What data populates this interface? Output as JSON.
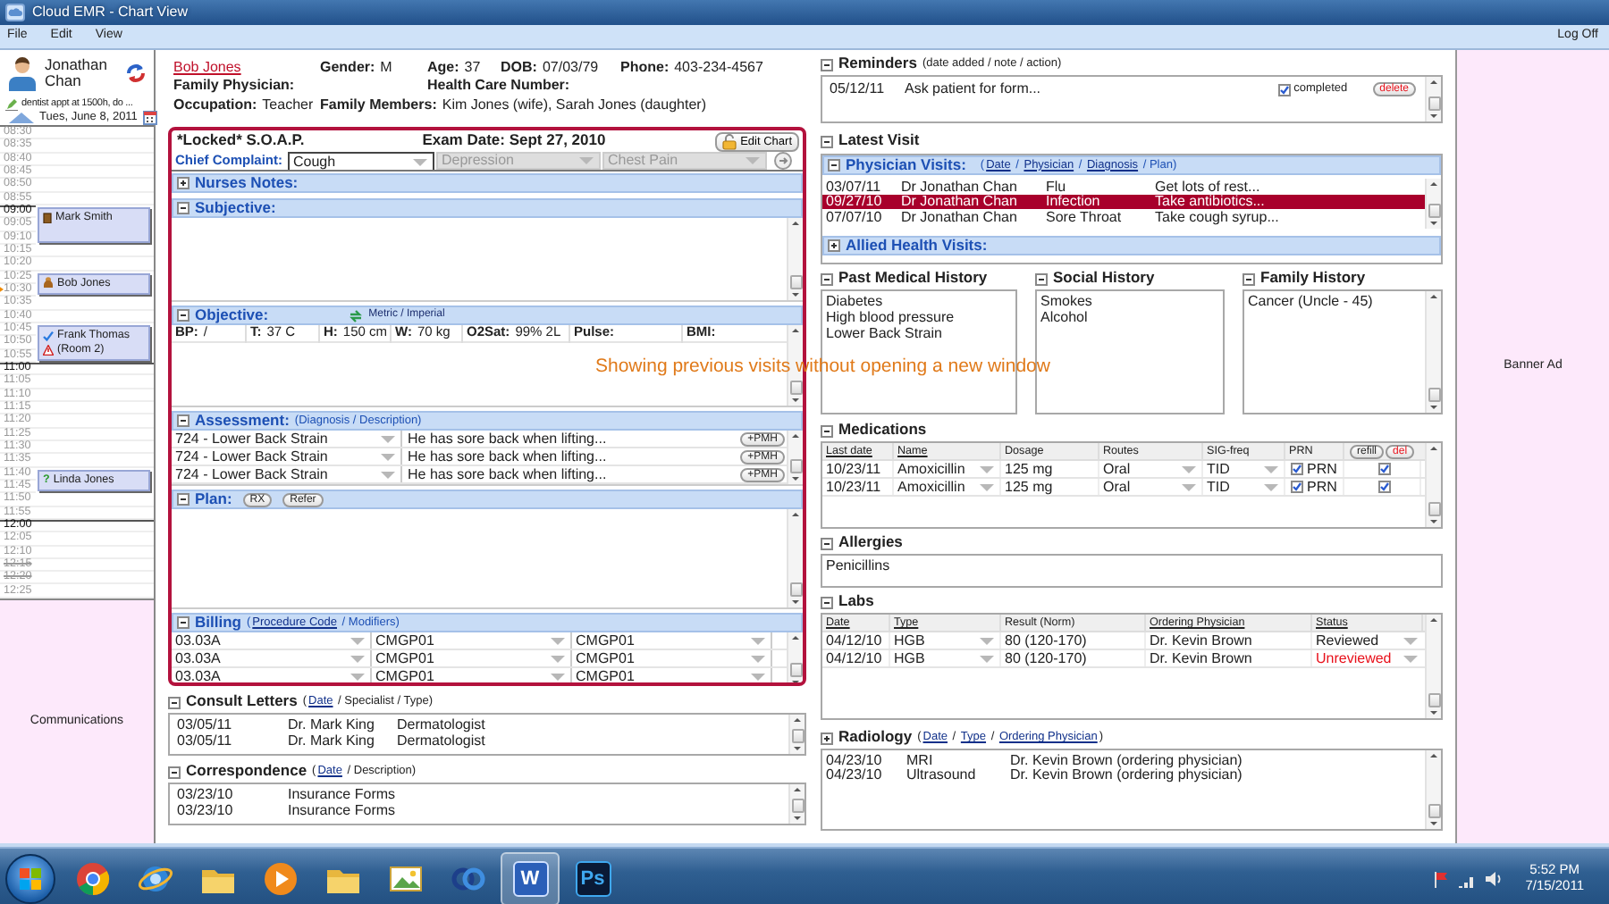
{
  "window": {
    "title": "Cloud EMR - Chart View"
  },
  "menu": [
    "File",
    "Edit",
    "View"
  ],
  "log_off": "Log Off",
  "sidebar": {
    "doctor": "Jonathan Chan",
    "note": "dentist appt at 1500h, do ...",
    "date": "Tues, June 8, 2011",
    "slots": [
      {
        "kind": "free",
        "time": "08:30",
        "hour": false,
        "struck": false,
        "now": false
      },
      {
        "kind": "free",
        "time": "08:35",
        "hour": false,
        "struck": false,
        "now": false
      },
      {
        "kind": "free",
        "time": "08:40",
        "hour": false,
        "struck": false,
        "now": false
      },
      {
        "kind": "free",
        "time": "08:45",
        "hour": false,
        "struck": false,
        "now": false
      },
      {
        "kind": "free",
        "time": "08:50",
        "hour": false,
        "struck": false,
        "now": false
      },
      {
        "kind": "free",
        "time": "08:55",
        "hour": false,
        "struck": false,
        "now": false
      },
      {
        "kind": "appointment",
        "times": [
          {
            "time": "09:00",
            "hour": true,
            "struck": false,
            "now": false
          },
          {
            "time": "09:05",
            "hour": false,
            "struck": false,
            "now": false
          },
          {
            "time": "09:10",
            "hour": false,
            "struck": false,
            "now": false
          }
        ],
        "patient": "Mark Smith",
        "badge": {
          "kind": "arrived"
        },
        "alert": false
      },
      {
        "kind": "free",
        "time": "10:15",
        "hour": false,
        "struck": false,
        "now": false
      },
      {
        "kind": "free",
        "time": "10:20",
        "hour": false,
        "struck": false,
        "now": false
      },
      {
        "kind": "appointment",
        "times": [
          {
            "time": "10:25",
            "hour": false,
            "struck": false,
            "now": false
          },
          {
            "time": "10:30",
            "hour": false,
            "struck": false,
            "now": true
          }
        ],
        "patient": "Bob Jones",
        "badge": {
          "kind": "waiting"
        },
        "alert": false
      },
      {
        "kind": "free",
        "time": "10:35",
        "hour": false,
        "struck": false,
        "now": false
      },
      {
        "kind": "free",
        "time": "10:40",
        "hour": false,
        "struck": false,
        "now": false
      },
      {
        "kind": "appointment",
        "times": [
          {
            "time": "10:45",
            "hour": false,
            "struck": false,
            "now": false
          },
          {
            "time": "10:50",
            "hour": false,
            "struck": false,
            "now": false
          },
          {
            "time": "10:55",
            "hour": false,
            "struck": false,
            "now": false
          }
        ],
        "patient": "Frank Thomas",
        "room": "(Room 2)",
        "badge": {
          "kind": "seen"
        },
        "alert": true
      },
      {
        "kind": "free",
        "time": "11:00",
        "hour": true,
        "struck": false,
        "now": false
      },
      {
        "kind": "free",
        "time": "11:05",
        "hour": false,
        "struck": false,
        "now": false
      },
      {
        "kind": "free",
        "time": "11:10",
        "hour": false,
        "struck": false,
        "now": false
      },
      {
        "kind": "free",
        "time": "11:15",
        "hour": false,
        "struck": false,
        "now": false
      },
      {
        "kind": "free",
        "time": "11:20",
        "hour": false,
        "struck": false,
        "now": false
      },
      {
        "kind": "free",
        "time": "11:25",
        "hour": false,
        "struck": false,
        "now": false
      },
      {
        "kind": "free",
        "time": "11:30",
        "hour": false,
        "struck": false,
        "now": false
      },
      {
        "kind": "free",
        "time": "11:35",
        "hour": false,
        "struck": false,
        "now": false
      },
      {
        "kind": "appointment",
        "times": [
          {
            "time": "11:40",
            "hour": false,
            "struck": false,
            "now": false
          },
          {
            "time": "11:45",
            "hour": false,
            "struck": false,
            "now": false
          }
        ],
        "patient": "Linda Jones",
        "badge": {
          "kind": "unconfirmed",
          "glyph": "?"
        },
        "alert": false
      },
      {
        "kind": "free",
        "time": "11:50",
        "hour": false,
        "struck": false,
        "now": false
      },
      {
        "kind": "free",
        "time": "11:55",
        "hour": false,
        "struck": false,
        "now": false
      },
      {
        "kind": "free",
        "time": "12:00",
        "hour": true,
        "struck": false,
        "now": false
      },
      {
        "kind": "free",
        "time": "12:05",
        "hour": false,
        "struck": false,
        "now": false
      },
      {
        "kind": "free",
        "time": "12:10",
        "hour": false,
        "struck": false,
        "now": false
      },
      {
        "kind": "free",
        "time": "12:15",
        "hour": false,
        "struck": true,
        "now": false
      },
      {
        "kind": "free",
        "time": "12:20",
        "hour": false,
        "struck": true,
        "now": false
      },
      {
        "kind": "free",
        "time": "12:25",
        "hour": false,
        "struck": false,
        "now": false
      }
    ],
    "communications": "Communications"
  },
  "patient": {
    "name": "Bob Jones",
    "fields": [
      {
        "label": "Gender:",
        "value": "M"
      },
      {
        "label": "Age:",
        "value": "37"
      },
      {
        "label": "DOB:",
        "value": "07/03/79"
      },
      {
        "label": "Phone:",
        "value": "403-234-4567"
      },
      {
        "label": "Family Physician:"
      },
      {
        "label": "Health Care Number:"
      },
      {
        "label": "Occupation:",
        "value": "Teacher"
      },
      {
        "label": "Family Members:",
        "value": "Kim Jones (wife), Sarah Jones (daughter)"
      }
    ]
  },
  "soap": {
    "title": "*Locked* S.O.A.P.",
    "exam_date": "Exam Date: Sept 27, 2010",
    "edit_button": "Edit Chart",
    "chief_complaint": {
      "label": "Chief Complaint:",
      "options": [
        {
          "value": "Cough",
          "disabled": false
        },
        {
          "value": "Depression",
          "disabled": true
        },
        {
          "value": "Chest Pain",
          "disabled": true
        }
      ]
    },
    "sections": [
      {
        "kind": "notes",
        "title": "Nurses Notes:",
        "expanded": false
      },
      {
        "kind": "text",
        "title": "Subjective:",
        "expanded": true
      },
      {
        "kind": "vitals",
        "title": "Objective:",
        "expanded": true,
        "units": "Metric / Imperial",
        "vitals": [
          {
            "label": "BP:",
            "value": "/"
          },
          {
            "label": "T:",
            "value": "37 C"
          },
          {
            "label": "H:",
            "value": "150 cm"
          },
          {
            "label": "W:",
            "value": "70 kg"
          },
          {
            "label": "O2Sat:",
            "value": "99% 2L"
          },
          {
            "label": "Pulse:"
          },
          {
            "label": "BMI:"
          }
        ]
      },
      {
        "kind": "assessment",
        "title": "Assessment:",
        "expanded": true,
        "hint": [
          {
            "text": "(Diagnosis / Description)",
            "link": false
          }
        ],
        "rows": [
          {
            "diagnosis": "724 - Lower Back Strain",
            "description": "He has sore back when lifting...",
            "action": "+PMH"
          },
          {
            "diagnosis": "724 - Lower Back Strain",
            "description": "He has sore back when lifting...",
            "action": "+PMH"
          },
          {
            "diagnosis": "724 - Lower Back Strain",
            "description": "He has sore back when lifting...",
            "action": "+PMH"
          }
        ]
      },
      {
        "kind": "plan",
        "title": "Plan:",
        "expanded": true,
        "buttons": [
          "RX",
          "Refer"
        ]
      },
      {
        "kind": "billing",
        "title": "Billing",
        "expanded": true,
        "hint": [
          {
            "text": "(",
            "link": false
          },
          {
            "text": "Procedure Code",
            "link": true
          },
          {
            "text": " / Modifiers)",
            "link": false
          }
        ],
        "rows": [
          [
            "03.03A",
            "CMGP01",
            "CMGP01"
          ],
          [
            "03.03A",
            "CMGP01",
            "CMGP01"
          ],
          [
            "03.03A",
            "CMGP01",
            "CMGP01"
          ]
        ]
      }
    ]
  },
  "consult_letters": {
    "title": "Consult Letters",
    "expanded": true,
    "hint": [
      {
        "text": "(",
        "link": false
      },
      {
        "text": "Date",
        "link": true
      },
      {
        "text": " / Specialist / Type)",
        "link": false
      }
    ],
    "rows": [
      [
        "03/05/11",
        "Dr. Mark King",
        "Dermatologist"
      ],
      [
        "03/05/11",
        "Dr. Mark King",
        "Dermatologist"
      ]
    ]
  },
  "correspondence": {
    "title": "Correspondence",
    "expanded": true,
    "hint": [
      {
        "text": "(",
        "link": false
      },
      {
        "text": "Date",
        "link": true
      },
      {
        "text": " / Description)",
        "link": false
      }
    ],
    "rows": [
      [
        "03/23/10",
        "Insurance Forms"
      ],
      [
        "03/23/10",
        "Insurance Forms"
      ]
    ]
  },
  "caption": "Showing previous visits without opening a new window",
  "reminders": {
    "title": "Reminders",
    "expanded": true,
    "hint": [
      {
        "text": "(date added / note / action)",
        "link": false
      }
    ],
    "items": [
      {
        "date": "05/12/11",
        "note": "Ask patient for form...",
        "completed": true,
        "completed_label": "completed",
        "delete": "delete"
      }
    ]
  },
  "latest_visit": {
    "title": "Latest Visit",
    "expanded": true,
    "physician_visits": {
      "title": "Physician Visits:",
      "expanded": true,
      "hint": [
        {
          "text": "(",
          "link": false
        },
        {
          "text": "Date",
          "link": true
        },
        {
          "text": " / ",
          "link": false
        },
        {
          "text": "Physician",
          "link": true
        },
        {
          "text": " / ",
          "link": false
        },
        {
          "text": "Diagnosis",
          "link": true
        },
        {
          "text": " / Plan)",
          "link": false
        }
      ],
      "rows": [
        {
          "cells": [
            "03/07/11",
            "Dr Jonathan Chan",
            "Flu",
            "Get lots of rest..."
          ],
          "selected": false
        },
        {
          "cells": [
            "09/27/10",
            "Dr Jonathan Chan",
            "Infection",
            "Take antibiotics..."
          ],
          "selected": true
        },
        {
          "cells": [
            "07/07/10",
            "Dr Jonathan Chan",
            "Sore Throat",
            "Take cough syrup..."
          ],
          "selected": false
        }
      ]
    },
    "allied_visits": {
      "title": "Allied Health Visits:",
      "expanded": false
    }
  },
  "histories": [
    {
      "title": "Past Medical History",
      "expanded": true,
      "items": [
        "Diabetes",
        "High blood pressure",
        "Lower Back Strain"
      ]
    },
    {
      "title": "Social History",
      "expanded": true,
      "items": [
        "Smokes",
        "Alcohol"
      ]
    },
    {
      "title": "Family History",
      "expanded": true,
      "items": [
        "Cancer (Uncle - 45)"
      ]
    }
  ],
  "medications": {
    "title": "Medications",
    "expanded": true,
    "columns": [
      {
        "label": "Last date",
        "link": true
      },
      {
        "label": "Name",
        "link": true
      },
      {
        "label": "Dosage",
        "link": false
      },
      {
        "label": "Routes",
        "link": false
      },
      {
        "label": "SIG-freq",
        "link": false
      },
      {
        "label": "PRN",
        "link": false
      }
    ],
    "refill": "refill",
    "delete": "del",
    "rows": [
      {
        "last_date": "10/23/11",
        "name": "Amoxicillin",
        "dosage": "125 mg",
        "route": "Oral",
        "frequency": "TID",
        "prn": true,
        "prn_label": "PRN",
        "refill": true
      },
      {
        "last_date": "10/23/11",
        "name": "Amoxicillin",
        "dosage": "125 mg",
        "route": "Oral",
        "frequency": "TID",
        "prn": true,
        "prn_label": "PRN",
        "refill": true
      }
    ]
  },
  "allergies": {
    "title": "Allergies",
    "expanded": true,
    "items": [
      "Penicillins"
    ]
  },
  "labs": {
    "title": "Labs",
    "expanded": true,
    "columns": [
      {
        "label": "Date",
        "link": true
      },
      {
        "label": "Type",
        "link": true
      },
      {
        "label": "Result (Norm)",
        "link": false
      },
      {
        "label": "Ordering Physician",
        "link": true
      },
      {
        "label": "Status",
        "link": true
      }
    ],
    "rows": [
      {
        "date": "04/12/10",
        "type": "HGB",
        "result": "80 (120-170)",
        "physician": "Dr. Kevin Brown",
        "status": "Reviewed",
        "reviewed": true
      },
      {
        "date": "04/12/10",
        "type": "HGB",
        "result": "80 (120-170)",
        "physician": "Dr. Kevin Brown",
        "status": "Unreviewed",
        "reviewed": false
      }
    ]
  },
  "radiology": {
    "title": "Radiology",
    "expanded": false,
    "hint": [
      {
        "text": "(",
        "link": false
      },
      {
        "text": "Date",
        "link": true
      },
      {
        "text": " / ",
        "link": false
      },
      {
        "text": "Type",
        "link": true
      },
      {
        "text": " / ",
        "link": false
      },
      {
        "text": "Ordering Physician",
        "link": true
      },
      {
        "text": ")",
        "link": false
      }
    ],
    "rows": [
      [
        "04/23/10",
        "MRI",
        "Dr. Kevin Brown (ordering physician)"
      ],
      [
        "04/23/10",
        "Ultrasound",
        "Dr. Kevin Brown (ordering physician)"
      ]
    ]
  },
  "banner": "Banner Ad",
  "taskbar": {
    "apps": [
      {
        "kind": "browser",
        "active": false
      },
      {
        "kind": "globe",
        "active": false
      },
      {
        "kind": "folder",
        "active": false
      },
      {
        "kind": "media",
        "active": false
      },
      {
        "kind": "folder",
        "active": false
      },
      {
        "kind": "gallery",
        "active": false
      },
      {
        "kind": "rings",
        "active": false
      },
      {
        "kind": "document",
        "glyph": "W",
        "active": true
      },
      {
        "kind": "design",
        "glyph": "Ps",
        "active": false
      }
    ],
    "time": "5:52 PM",
    "date": "7/15/2011"
  }
}
